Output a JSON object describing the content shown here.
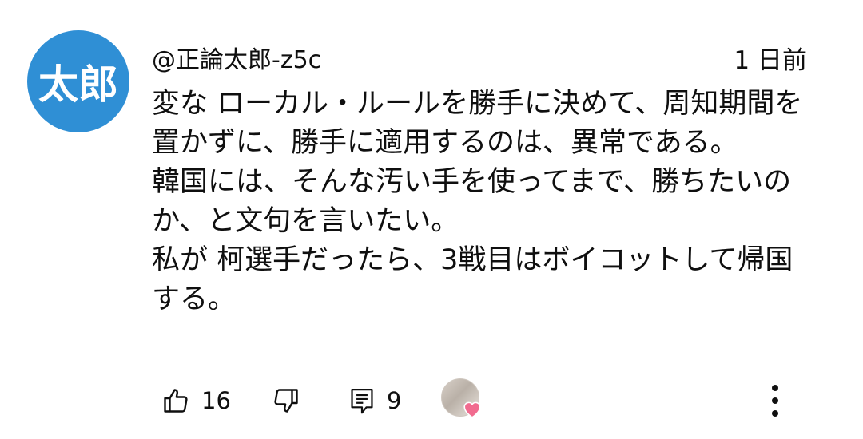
{
  "comment": {
    "avatar_text": "太郎",
    "author": "@正論太郎-z5c",
    "time": "1 日前",
    "text_lines": [
      "変な ローカル・ルールを勝手に決めて、周知期間を置かずに、勝手に適用するのは、異常である。",
      "韓国には、そんな汚い手を使ってまで、勝ちたいのか、と文句を言いたい。",
      "私が 柯選手だったら、3戦目はボイコットして帰国する。"
    ]
  },
  "actions": {
    "like_count": "16",
    "reply_count": "9",
    "like_icon": "thumbs-up-icon",
    "dislike_icon": "thumbs-down-icon",
    "reply_icon": "comment-icon",
    "creator_heart_icon": "heart-icon",
    "more_icon": "more-vert-icon"
  },
  "colors": {
    "avatar_bg": "#2f8fd5",
    "heart": "#f16b8f",
    "text": "#0f0f0f"
  }
}
